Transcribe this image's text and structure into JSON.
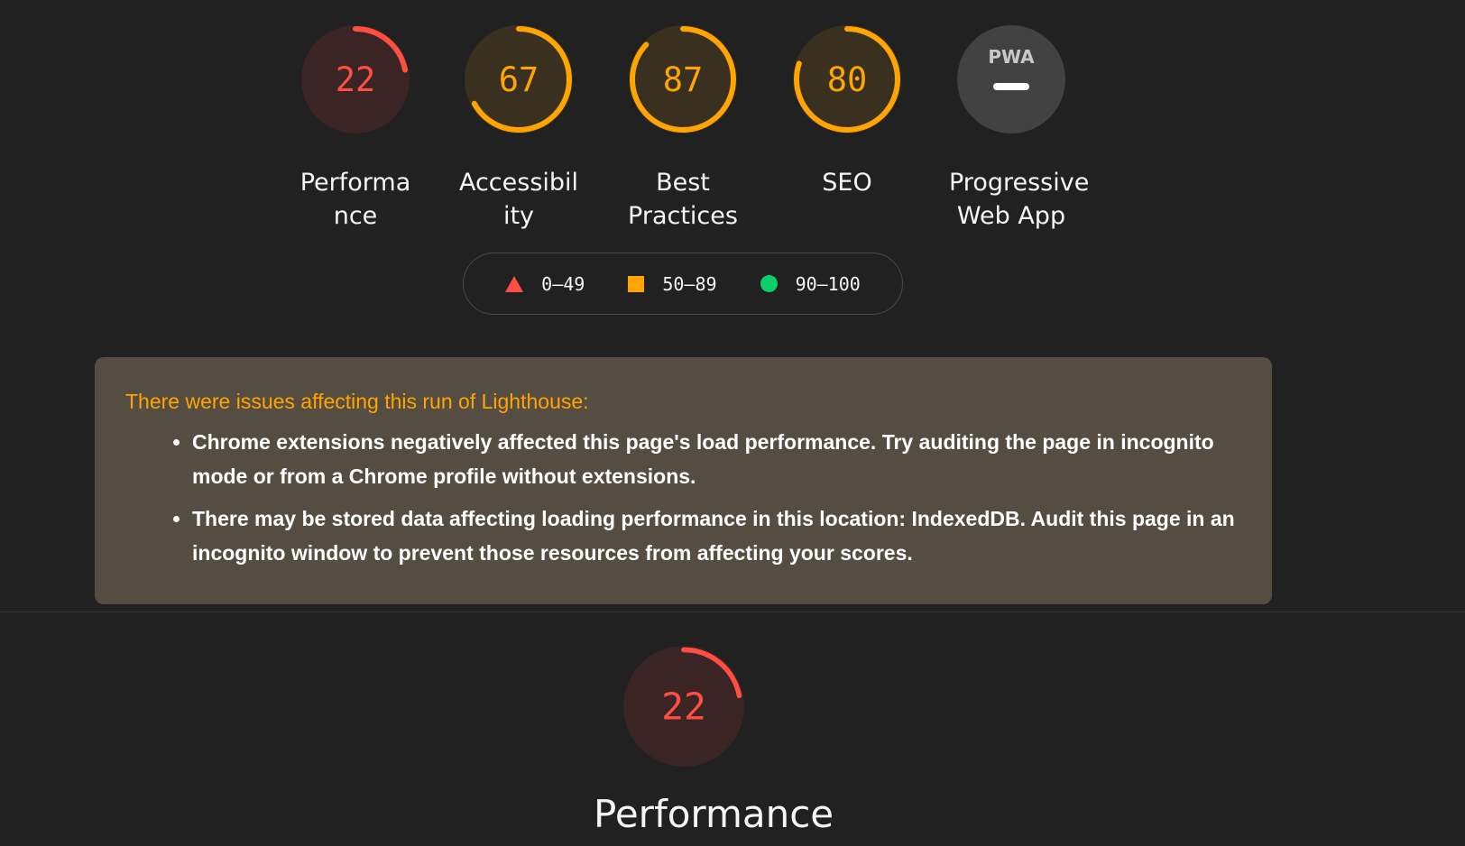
{
  "gauges": [
    {
      "score": "22",
      "label": "Performance",
      "value": 22,
      "color": "#ff4e42",
      "bg": "#3a2424"
    },
    {
      "score": "67",
      "label": "Accessibility",
      "value": 67,
      "color": "#ffa400",
      "bg": "#3a3020"
    },
    {
      "score": "87",
      "label": "Best Practices",
      "value": 87,
      "color": "#ffa400",
      "bg": "#3a3020"
    },
    {
      "score": "80",
      "label": "SEO",
      "value": 80,
      "color": "#ffa400",
      "bg": "#3a3020"
    }
  ],
  "pwa": {
    "badge": "PWA",
    "label": "Progressive Web App",
    "bg": "#424242"
  },
  "legend": {
    "fail": "0–49",
    "average": "50–89",
    "pass": "90–100"
  },
  "warnings": {
    "title": "There were issues affecting this run of Lighthouse:",
    "items": [
      "Chrome extensions negatively affected this page's load performance. Try auditing the page in incognito mode or from a Chrome profile without extensions.",
      "There may be stored data affecting loading performance in this location: IndexedDB. Audit this page in an incognito window to prevent those resources from affecting your scores."
    ]
  },
  "performance": {
    "score": "22",
    "label": "Performance",
    "value": 22,
    "color": "#ff4e42",
    "bg": "#3a2424"
  },
  "colors": {
    "fail": "#ff4e42",
    "average": "#ffa400",
    "pass": "#0cce6b"
  }
}
